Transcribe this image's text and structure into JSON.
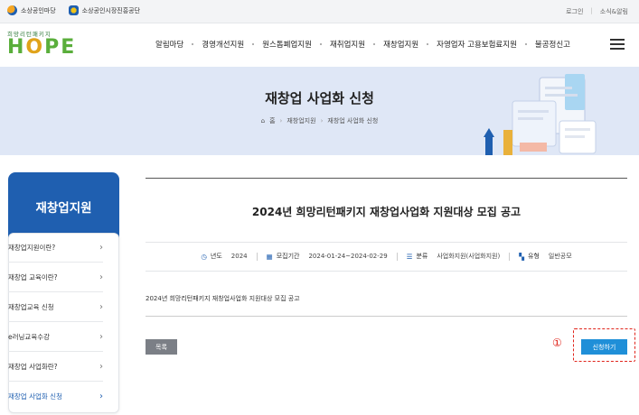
{
  "utilbar": {
    "site1": "소상공인마당",
    "site2": "소상공인시장진흥공단",
    "login": "로그인",
    "news": "소식&알림"
  },
  "header": {
    "brand_sub": "희망리턴패키지",
    "brand_main_1": "H",
    "brand_main_2": "O",
    "brand_main_3": "PE",
    "nav": [
      "알림마당",
      "경영개선지원",
      "원스톱폐업지원",
      "재취업지원",
      "재창업지원",
      "자영업자 고용보험료지원",
      "불공정신고"
    ]
  },
  "hero": {
    "title": "재창업 사업화 신청",
    "breadcrumb": [
      "홈",
      "재창업지원",
      "재창업 사업화 신청"
    ]
  },
  "sidebar": {
    "title": "재창업지원",
    "items": [
      {
        "label": "재창업지원이란?"
      },
      {
        "label": "재창업 교육이란?"
      },
      {
        "label": "재창업교육 신청"
      },
      {
        "label": "e러닝교육수강"
      },
      {
        "label": "재창업 사업화란?"
      },
      {
        "label": "재창업 사업화 신청"
      }
    ]
  },
  "post": {
    "title": "2024년 희망리턴패키지 재창업사업화 지원대상 모집 공고",
    "meta": {
      "year_label": "년도",
      "year_value": "2024",
      "period_label": "모집기간",
      "period_value": "2024-01-24~2024-02-29",
      "category_label": "분류",
      "category_value": "사업화지원(사업화지원)",
      "type_label": "유형",
      "type_value": "일반공모"
    },
    "body": "2024년 희망리턴패키지 재창업사업화 지원대상 모집 공고"
  },
  "buttons": {
    "list": "목록",
    "apply": "신청하기"
  },
  "annotation": {
    "number": "①",
    "color": "#e0241b"
  },
  "colors": {
    "primary": "#1f5fb0",
    "apply": "#1f8fd8",
    "hero_bg": "#dfe7f6"
  }
}
